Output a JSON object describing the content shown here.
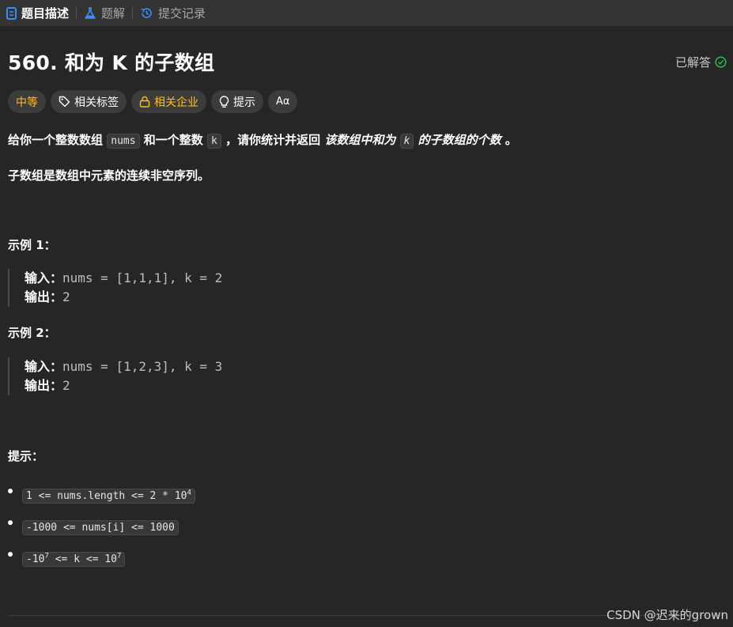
{
  "tabs": [
    {
      "label": "题目描述",
      "icon": "document-icon"
    },
    {
      "label": "题解",
      "icon": "flask-icon"
    },
    {
      "label": "提交记录",
      "icon": "history-icon"
    }
  ],
  "problem": {
    "title": "560. 和为 K 的子数组",
    "status": "已解答",
    "tags": {
      "difficulty": "中等",
      "related_tags": "相关标签",
      "related_companies": "相关企业",
      "hint": "提示",
      "font": "Aα"
    }
  },
  "description": {
    "p1_a": "给你一个整数数组",
    "p1_code1": "nums",
    "p1_b": "和一个整数",
    "p1_code2": "k",
    "p1_c": "，请你统计并返回",
    "p1_em1": "该数组中和为",
    "p1_code3": "k",
    "p1_em2": "的子数组的个数",
    "p1_end": "。",
    "p2": "子数组是数组中元素的连续非空序列。"
  },
  "examples": [
    {
      "heading": "示例 1：",
      "input_label": "输入：",
      "input": "nums = [1,1,1], k = 2",
      "output_label": "输出：",
      "output": "2"
    },
    {
      "heading": "示例 2：",
      "input_label": "输入：",
      "input": "nums = [1,2,3], k = 3",
      "output_label": "输出：",
      "output": "2"
    }
  ],
  "constraints": {
    "heading": "提示：",
    "items": [
      {
        "pre": "1 <= nums.length <= 2 * 10",
        "sup": "4",
        "post": ""
      },
      {
        "pre": "-1000 <= nums[i] <= 1000",
        "sup": "",
        "post": ""
      },
      {
        "pre": "-10",
        "sup": "7",
        "mid": " <= k <= 10",
        "sup2": "7"
      }
    ]
  },
  "watermark": "CSDN @迟来的grown"
}
